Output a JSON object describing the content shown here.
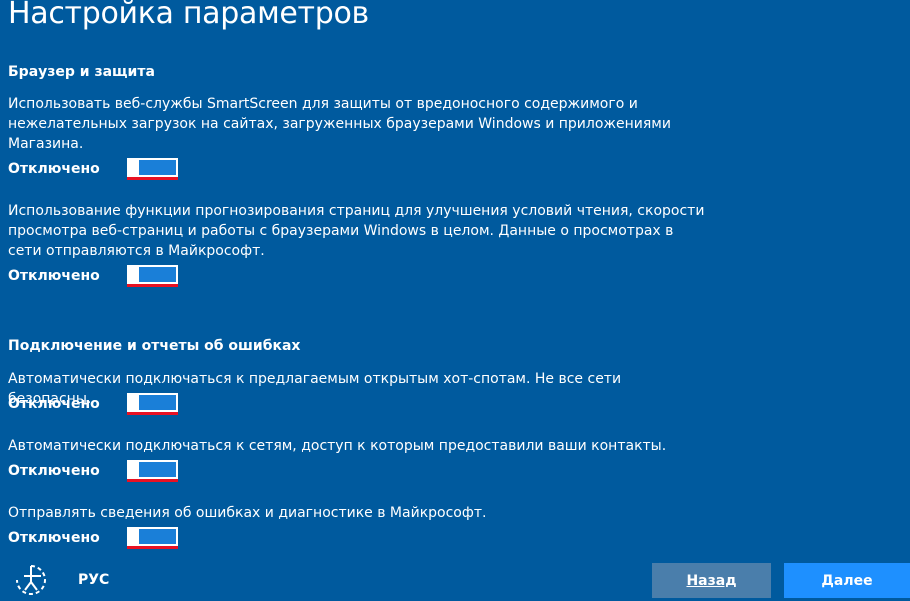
{
  "page": {
    "title": "Настройка параметров"
  },
  "sections": [
    {
      "heading": "Браузер и защита",
      "items": [
        {
          "description": "Использовать веб-службы SmartScreen для защиты от вредоносного содержимого и нежелательных загрузок на сайтах, загруженных браузерами Windows и приложениями Магазина.",
          "state_label": "Отключено",
          "on": false
        },
        {
          "description": "Использование функции прогнозирования страниц для улучшения условий чтения, скорости просмотра веб-страниц и работы с браузерами Windows в целом. Данные о просмотрах в сети отправляются в Майкрософт.",
          "state_label": "Отключено",
          "on": false
        }
      ]
    },
    {
      "heading": "Подключение и отчеты об ошибках",
      "items": [
        {
          "description": "Автоматически подключаться к предлагаемым открытым хот-спотам. Не все сети безопасны.",
          "state_label": "Отключено",
          "on": false
        },
        {
          "description": "Автоматически подключаться к сетям, доступ к которым предоставили ваши контакты.",
          "state_label": "Отключено",
          "on": false
        },
        {
          "description": "Отправлять сведения об ошибках и диагностике в Майкрософт.",
          "state_label": "Отключено",
          "on": false
        }
      ]
    }
  ],
  "footer": {
    "accessibility_icon": "ease-of-access-icon",
    "language": "РУС",
    "back_label": "Назад",
    "next_label": "Далее"
  },
  "colors": {
    "background": "#005a9e",
    "toggle_track": "#1a7fd8",
    "toggle_underline": "#e81123",
    "back_button": "#4a7eab",
    "next_button": "#1e90ff"
  }
}
